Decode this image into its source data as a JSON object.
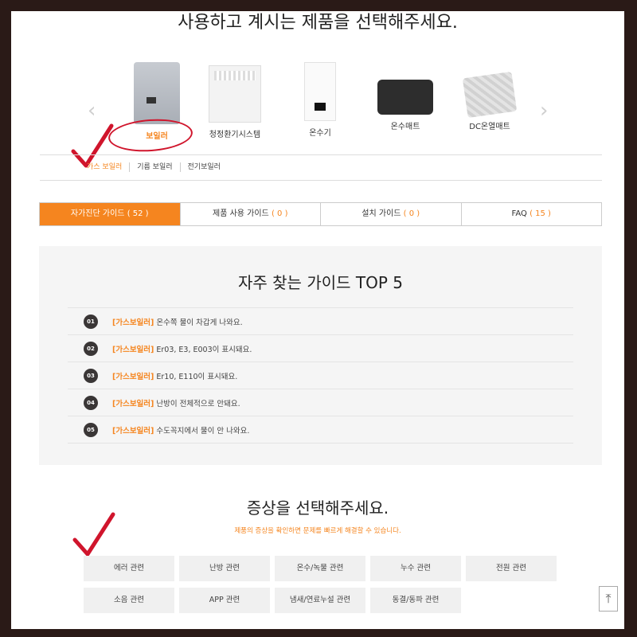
{
  "page_title": "사용하고 계시는 제품을 선택해주세요.",
  "products": [
    {
      "label": "보일러"
    },
    {
      "label": "청정환기시스템"
    },
    {
      "label": "온수기"
    },
    {
      "label": "온수매트"
    },
    {
      "label": "DC온열매트"
    }
  ],
  "subnav": [
    "가스 보일러",
    "기름 보일러",
    "전기보일러"
  ],
  "tabs": [
    {
      "label": "자가진단 가이드",
      "count": "( 52 )"
    },
    {
      "label": "제품 사용 가이드",
      "count": "( 0 )"
    },
    {
      "label": "설치 가이드",
      "count": "( 0 )"
    },
    {
      "label": "FAQ",
      "count": "( 15 )"
    }
  ],
  "top5": {
    "title": "자주 찾는 가이드 TOP 5",
    "items": [
      {
        "num": "01",
        "cat": "[가스보일러]",
        "text": "온수쪽 물이 차갑게 나와요."
      },
      {
        "num": "02",
        "cat": "[가스보일러]",
        "text": "Er03, E3, E003이 표시돼요."
      },
      {
        "num": "03",
        "cat": "[가스보일러]",
        "text": "Er10, E110이 표시돼요."
      },
      {
        "num": "04",
        "cat": "[가스보일러]",
        "text": "난방이 전체적으로 안돼요."
      },
      {
        "num": "05",
        "cat": "[가스보일러]",
        "text": "수도꼭지에서 물이 안 나와요."
      }
    ]
  },
  "symptoms": {
    "title": "증상을 선택해주세요.",
    "subtitle": "제품의 증상을 확인하면 문제를 빠르게 해결할 수 있습니다.",
    "buttons": [
      "에러 관련",
      "난방 관련",
      "온수/녹물 관련",
      "누수 관련",
      "전원 관련",
      "소음 관련",
      "APP 관련",
      "냄새/연료누설 관련",
      "동결/동파 관련"
    ]
  },
  "colors": {
    "accent": "#f5851f",
    "annotation": "#d0152c",
    "frame": "#2a1a17"
  },
  "icons": {
    "prev": "chevron-left-icon",
    "next": "chevron-right-icon",
    "top": "arrow-up-icon"
  }
}
